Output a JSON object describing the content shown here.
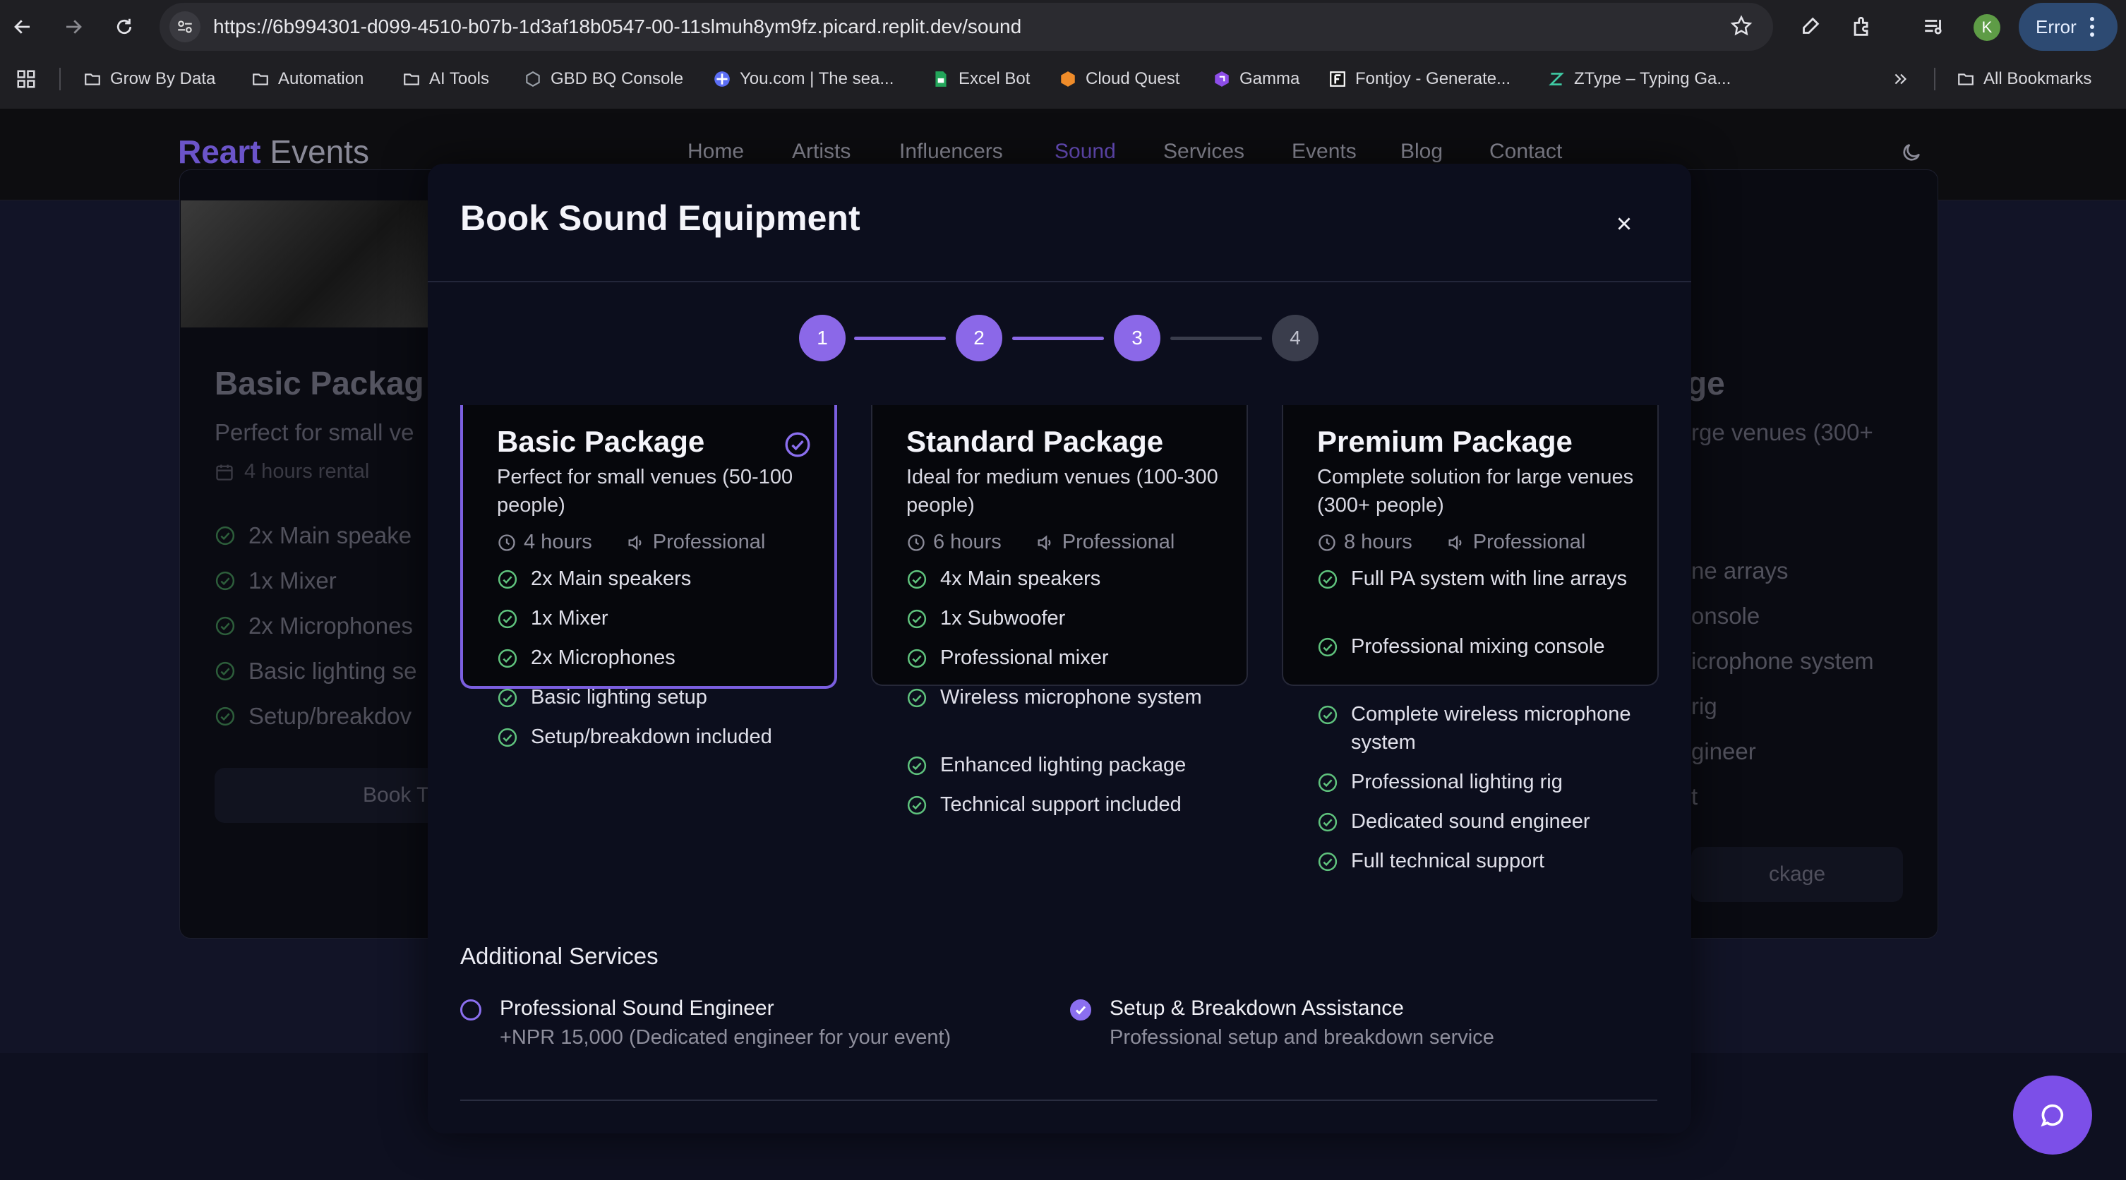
{
  "browser": {
    "url": "https://6b994301-d099-4510-b07b-1d3af18b0547-00-11slmuh8ym9fz.picard.replit.dev/sound",
    "profile_initial": "K",
    "error_label": "Error",
    "bookmarks": [
      "Grow By Data",
      "Automation",
      "AI Tools",
      "GBD BQ Console",
      "You.com | The sea...",
      "Excel Bot",
      "Cloud Quest",
      "Gamma",
      "Fontjoy - Generate...",
      "ZType – Typing Ga..."
    ],
    "all_bookmarks": "All Bookmarks"
  },
  "site": {
    "brand_main": "Reart",
    "brand_sub": "Events",
    "nav": [
      "Home",
      "Artists",
      "Influencers",
      "Sound",
      "Services",
      "Events",
      "Blog",
      "Contact"
    ],
    "active_nav": "Sound",
    "bg_left": {
      "title": "Basic Packag",
      "desc": "Perfect for small ve",
      "rental": "4 hours rental",
      "features": [
        "2x Main speake",
        "1x Mixer",
        "2x Microphones",
        "Basic lighting se",
        "Setup/breakdov"
      ],
      "button": "Book T"
    },
    "bg_right": {
      "title": "ge",
      "desc": "rge venues (300+",
      "features": [
        "ne arrays",
        "onsole",
        "icrophone system",
        "rig",
        "gineer",
        "t"
      ],
      "button": "ckage"
    }
  },
  "modal": {
    "title": "Book Sound Equipment",
    "steps": [
      "1",
      "2",
      "3",
      "4"
    ],
    "current_step": 3,
    "packages": [
      {
        "title": "Basic Package",
        "desc": "Perfect for small venues (50-100 people)",
        "hours": "4 hours",
        "level": "Professional",
        "selected": true,
        "features": [
          "2x Main speakers",
          "1x Mixer",
          "2x Microphones",
          "Basic lighting setup",
          "Setup/breakdown included"
        ]
      },
      {
        "title": "Standard Package",
        "desc": "Ideal for medium venues (100-300 people)",
        "hours": "6 hours",
        "level": "Professional",
        "selected": false,
        "features": [
          "4x Main speakers",
          "1x Subwoofer",
          "Professional mixer",
          "Wireless microphone system",
          "Enhanced lighting package",
          "Technical support included"
        ]
      },
      {
        "title": "Premium Package",
        "desc": "Complete solution for large venues (300+ people)",
        "hours": "8 hours",
        "level": "Professional",
        "selected": false,
        "features": [
          "Full PA system with line arrays",
          "Professional mixing console",
          "Complete wireless microphone system",
          "Professional lighting rig",
          "Dedicated sound engineer",
          "Full technical support"
        ]
      }
    ],
    "additional_title": "Additional Services",
    "services": [
      {
        "name": "Professional Sound Engineer",
        "desc": "+NPR 15,000 (Dedicated engineer for your event)",
        "checked": false
      },
      {
        "name": "Setup & Breakdown Assistance",
        "desc": "Professional setup and breakdown service",
        "checked": true
      }
    ]
  },
  "colors": {
    "accent": "#8b68e8",
    "check": "#5fc27d",
    "modal_bg": "#0c0e1d"
  }
}
